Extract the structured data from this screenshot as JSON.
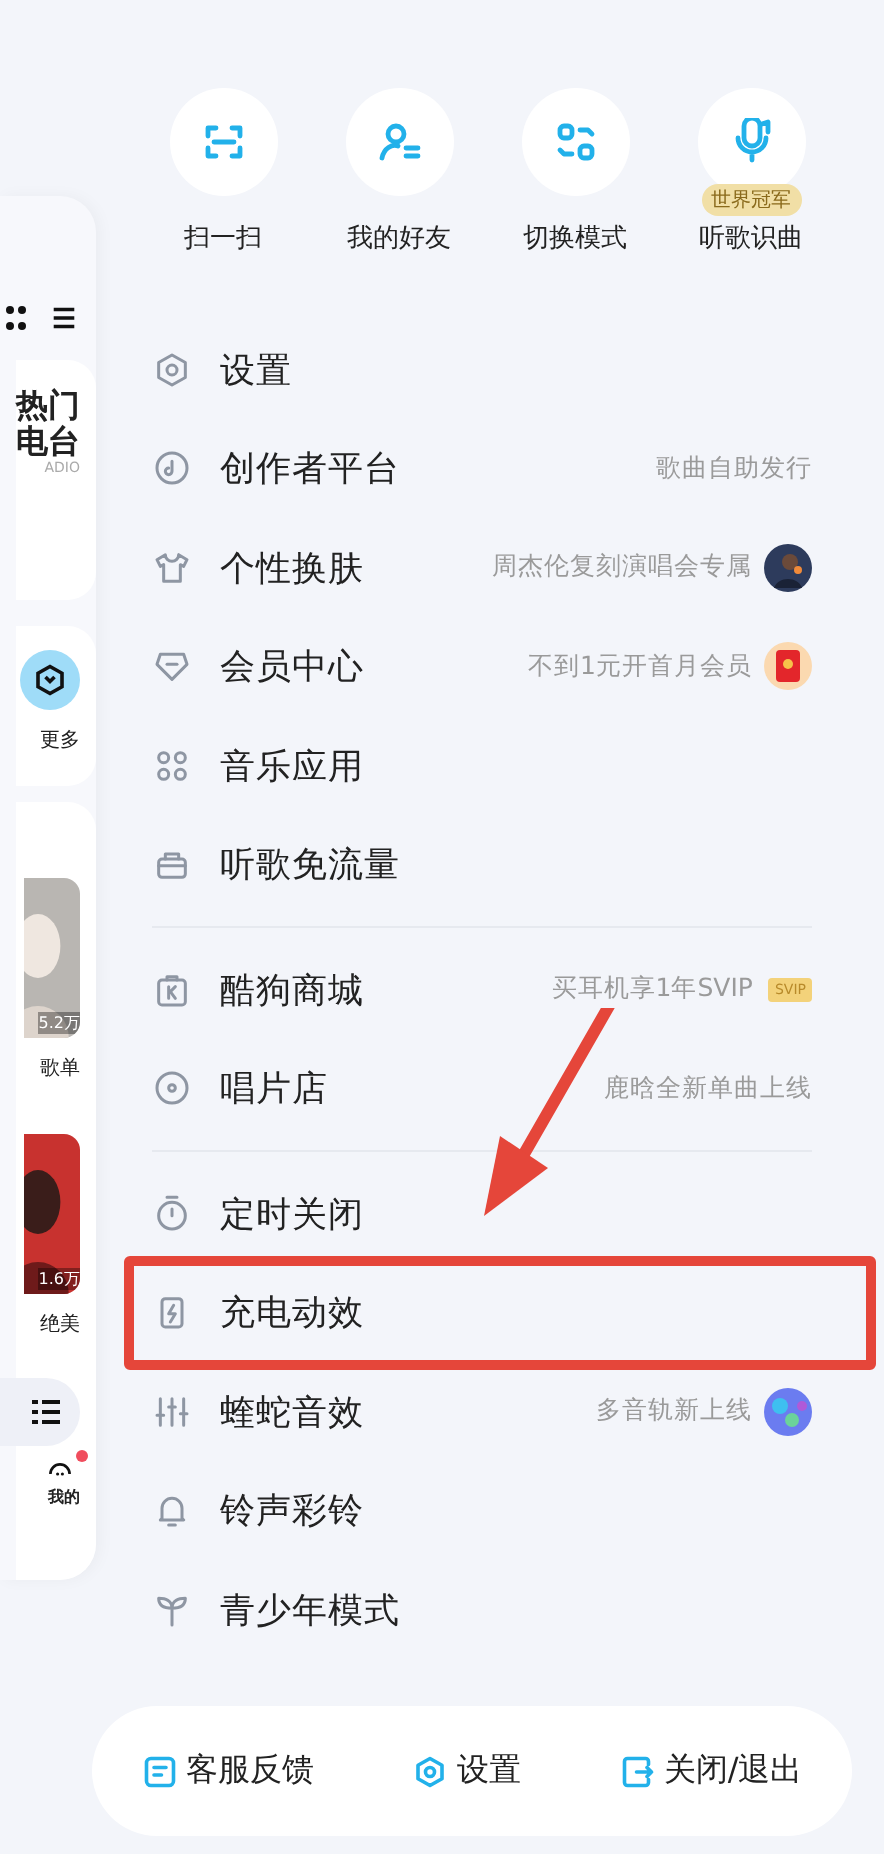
{
  "left_panel": {
    "radio_title": [
      "热门",
      "电台"
    ],
    "radio_sub": "ADIO",
    "more": "更多",
    "playlists": [
      {
        "count": "5.2万",
        "caption": "歌单"
      },
      {
        "count": "1.6万",
        "caption": "绝美"
      }
    ],
    "me": "我的",
    "me_dot": true
  },
  "quick_actions": [
    {
      "label": "扫一扫"
    },
    {
      "label": "我的好友"
    },
    {
      "label": "切换模式"
    },
    {
      "label": "听歌识曲",
      "badge": "世界冠军"
    }
  ],
  "menu_groups": [
    [
      {
        "kind": "plain",
        "label": "设置",
        "highlighted": false
      },
      {
        "kind": "plain",
        "label": "创作者平台",
        "hint": "歌曲自助发行",
        "highlighted": false
      },
      {
        "kind": "avatar",
        "label": "个性换肤",
        "hint": "周杰伦复刻演唱会专属",
        "highlighted": false
      },
      {
        "kind": "envelope",
        "label": "会员中心",
        "hint": "不到1元开首月会员",
        "highlighted": false
      },
      {
        "kind": "plain",
        "label": "音乐应用",
        "highlighted": false
      },
      {
        "kind": "plain",
        "label": "听歌免流量",
        "highlighted": false
      }
    ],
    [
      {
        "kind": "tag",
        "label": "酷狗商城",
        "hint": "买耳机享1年SVIP",
        "tag": "SVIP",
        "highlighted": false
      },
      {
        "kind": "plain",
        "label": "唱片店",
        "hint": "鹿晗全新单曲上线",
        "highlighted": false
      }
    ],
    [
      {
        "kind": "plain",
        "label": "定时关闭",
        "highlighted": false
      },
      {
        "kind": "plain",
        "label": "充电动效",
        "highlighted": true
      },
      {
        "kind": "orb",
        "label": "蝰蛇音效",
        "hint": "多音轨新上线",
        "highlighted": false
      },
      {
        "kind": "plain",
        "label": "铃声彩铃",
        "highlighted": false
      },
      {
        "kind": "plain",
        "label": "青少年模式",
        "highlighted": false
      }
    ]
  ],
  "bottom_bar": [
    {
      "label": "客服反馈"
    },
    {
      "label": "设置"
    },
    {
      "label": "关闭/退出"
    }
  ]
}
